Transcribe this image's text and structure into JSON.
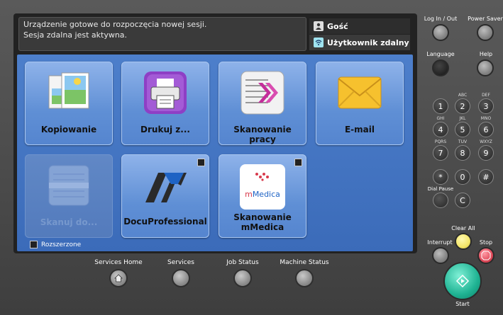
{
  "message": {
    "line1": "Urządzenie gotowe do rozpoczęcia nowej sesji.",
    "line2": "Sesja zdalna jest aktywna."
  },
  "users": {
    "guest": "Gość",
    "remote": "Użytkownik zdalny"
  },
  "tiles": {
    "copy": "Kopiowanie",
    "print": "Drukuj z...",
    "scan_work": "Skanowanie pracy",
    "email": "E-mail",
    "scan_to": "Skanuj do...",
    "docu": "DocuProfessional",
    "mmedica_l1": "Skanowanie",
    "mmedica_l2": "mMedica",
    "mmedica_logo_m": "m",
    "mmedica_logo_rest": "Medica"
  },
  "extended": "Rozszerzone",
  "bottom": {
    "services_home": "Services Home",
    "services": "Services",
    "job_status": "Job Status",
    "machine_status": "Machine Status"
  },
  "side": {
    "login": "Log In / Out",
    "power_saver": "Power Saver",
    "language": "Language",
    "help": "Help",
    "dial_pause": "Dial Pause",
    "clear_all": "Clear All",
    "interrupt": "Interrupt",
    "stop": "Stop",
    "start": "Start"
  },
  "keypad": {
    "k1": "1",
    "k2": "2",
    "k3": "3",
    "k4": "4",
    "k5": "5",
    "k6": "6",
    "k7": "7",
    "k8": "8",
    "k9": "9",
    "star": "*",
    "k0": "0",
    "hash": "#",
    "c": "C",
    "s2": "ABC",
    "s3": "DEF",
    "s4": "GHI",
    "s5": "JKL",
    "s6": "MNO",
    "s7": "PQRS",
    "s8": "TUV",
    "s9": "WXYZ"
  },
  "colors": {
    "panel": "#4d7fcb",
    "start": "#1fb393",
    "clear_all": "#f4e66a",
    "stop": "#e04a5a"
  }
}
